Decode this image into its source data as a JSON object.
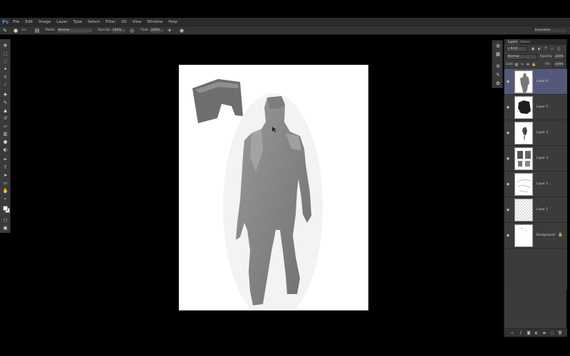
{
  "app": {
    "logo": "Ps"
  },
  "menu": [
    "File",
    "Edit",
    "Image",
    "Layer",
    "Type",
    "Select",
    "Filter",
    "3D",
    "View",
    "Window",
    "Help"
  ],
  "options": {
    "brush_size": "100",
    "mode_label": "Mode:",
    "mode_value": "Normal",
    "opacity_label": "Opacity:",
    "opacity_value": "100%",
    "flow_label": "Flow:",
    "flow_value": "100%",
    "workspace": "Essentials"
  },
  "tools": [
    "move-tool",
    "marquee-tool",
    "lasso-tool",
    "quick-select-tool",
    "crop-tool",
    "eyedropper-tool",
    "healing-tool",
    "brush-tool",
    "stamp-tool",
    "history-brush-tool",
    "eraser-tool",
    "gradient-tool",
    "blur-tool",
    "dodge-tool",
    "pen-tool",
    "type-tool",
    "path-select-tool",
    "shape-tool",
    "hand-tool",
    "zoom-tool"
  ],
  "layers_panel": {
    "tabs": [
      "Layers",
      "History"
    ],
    "filter_label": "Kind",
    "blend_mode": "Normal",
    "opacity_label": "Opacity:",
    "opacity_value": "100%",
    "lock_label": "Lock:",
    "fill_label": "Fill:",
    "fill_value": "100%",
    "layers": [
      {
        "name": "Layer 6",
        "selected": true
      },
      {
        "name": "Layer 5",
        "selected": false
      },
      {
        "name": "Layer 4",
        "selected": false
      },
      {
        "name": "Layer 3",
        "selected": false
      },
      {
        "name": "Layer 2",
        "selected": false
      },
      {
        "name": "Layer 1",
        "selected": false
      },
      {
        "name": "Background",
        "selected": false
      }
    ]
  },
  "colors": {
    "accent": "#4a90d9",
    "selection": "#55587a",
    "figure": "#8a8a8a"
  }
}
